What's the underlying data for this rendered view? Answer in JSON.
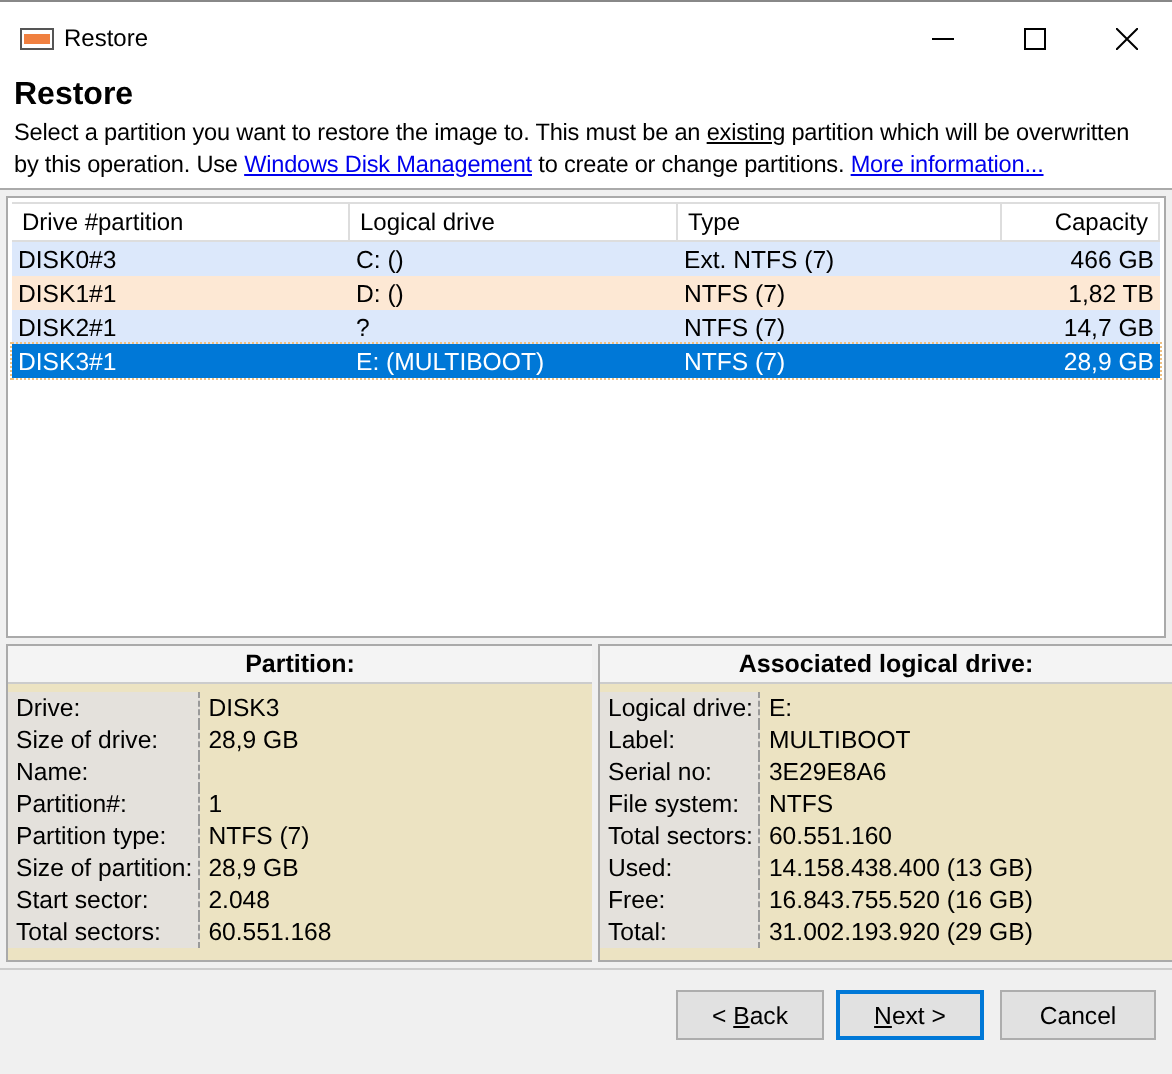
{
  "window": {
    "title": "Restore"
  },
  "heading": "Restore",
  "description": [
    {
      "kind": "text",
      "text": "Select a partition you want to restore the image to. This must be an "
    },
    {
      "kind": "underline",
      "text": "existing"
    },
    {
      "kind": "text",
      "text": " partition which will be overwritten by this operation. Use "
    },
    {
      "kind": "link",
      "text": "Windows Disk Management"
    },
    {
      "kind": "text",
      "text": " to create or change partitions. "
    },
    {
      "kind": "link",
      "text": "More information..."
    }
  ],
  "table": {
    "columns": [
      "Drive #partition",
      "Logical drive",
      "Type",
      "Capacity"
    ],
    "rows": [
      {
        "cells": [
          "DISK0#3",
          "C: ()",
          "Ext. NTFS (7)",
          "466 GB"
        ],
        "selected": false
      },
      {
        "cells": [
          "DISK1#1",
          "D: ()",
          "NTFS (7)",
          "1,82 TB"
        ],
        "selected": false
      },
      {
        "cells": [
          "DISK2#1",
          "?",
          "NTFS (7)",
          "14,7 GB"
        ],
        "selected": false
      },
      {
        "cells": [
          "DISK3#1",
          "E: (MULTIBOOT)",
          "NTFS (7)",
          "28,9 GB"
        ],
        "selected": true
      }
    ]
  },
  "panels": [
    {
      "title": "Partition:",
      "fields": [
        {
          "label": "Drive:",
          "value": "DISK3"
        },
        {
          "label": "Size of drive:",
          "value": "28,9 GB"
        },
        {
          "label": "Name:"
        },
        {
          "label": "Partition#:",
          "value": "1"
        },
        {
          "label": "Partition type:",
          "value": "NTFS (7)"
        },
        {
          "label": "Size of partition:",
          "value": "28,9 GB"
        },
        {
          "label": "Start sector:",
          "value": "2.048"
        },
        {
          "label": "Total sectors:",
          "value": "60.551.168"
        }
      ]
    },
    {
      "title": "Associated logical drive:",
      "fields": [
        {
          "label": "Logical drive:",
          "value": "E:"
        },
        {
          "label": "Label:",
          "value": "MULTIBOOT"
        },
        {
          "label": "Serial no:",
          "value": "3E29E8A6"
        },
        {
          "label": "File system:",
          "value": "NTFS"
        },
        {
          "label": "Total sectors:",
          "value": "60.551.160"
        },
        {
          "label": "Used:",
          "value": "14.158.438.400 (13 GB)"
        },
        {
          "label": "Free:",
          "value": "16.843.755.520 (16 GB)"
        },
        {
          "label": "Total:",
          "value": "31.002.193.920 (29 GB)"
        }
      ]
    }
  ],
  "buttons": [
    {
      "before": "< ",
      "key": "B",
      "after": "ack",
      "default": false
    },
    {
      "key": "N",
      "after": "ext >",
      "default": true
    },
    {
      "before": "Cancel",
      "default": false
    }
  ]
}
